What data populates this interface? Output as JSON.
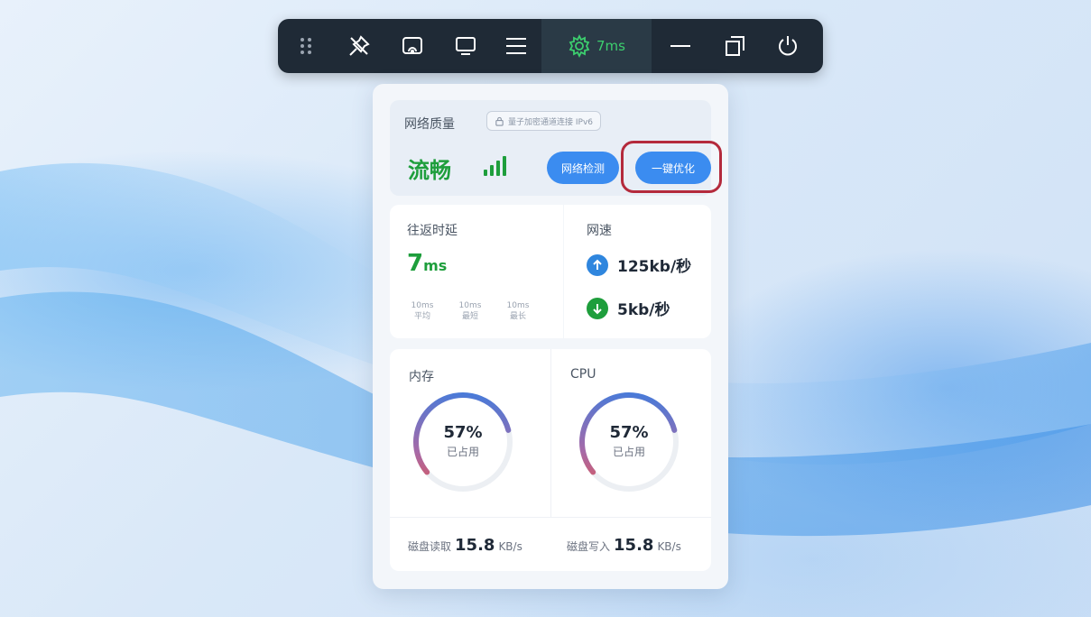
{
  "toolbar": {
    "ping": "7ms",
    "icons": [
      "grip-icon",
      "unpin-icon",
      "cast-icon",
      "monitor-icon",
      "menu-icon",
      "network-icon",
      "minimize-icon",
      "restore-icon",
      "power-icon"
    ]
  },
  "network_quality": {
    "title": "网络质量",
    "badge": "量子加密通道连接 IPv6",
    "status": "流畅",
    "signal_level": 4,
    "check_button": "网络检测",
    "optimize_button": "一键优化"
  },
  "latency": {
    "title": "往返时延",
    "value": "7",
    "unit": "ms",
    "stats": [
      {
        "value": "10ms",
        "label": "平均"
      },
      {
        "value": "10ms",
        "label": "最短"
      },
      {
        "value": "10ms",
        "label": "最长"
      }
    ]
  },
  "speed": {
    "title": "网速",
    "upload": "125kb/秒",
    "download": "5kb/秒"
  },
  "memory": {
    "title": "内存",
    "percent": "57%",
    "percent_value": 57,
    "sub": "已占用"
  },
  "cpu": {
    "title": "CPU",
    "percent": "57%",
    "percent_value": 57,
    "sub": "已占用"
  },
  "disk": {
    "read_label": "磁盘读取",
    "read_value": "15.8",
    "read_unit": "KB/s",
    "write_label": "磁盘写入",
    "write_value": "15.8",
    "write_unit": "KB/s"
  },
  "colors": {
    "accent_green": "#1e9e3c",
    "button_blue": "#3b8cf0",
    "highlight_red": "#b42a3c",
    "toolbar_bg": "#1f2a36"
  }
}
